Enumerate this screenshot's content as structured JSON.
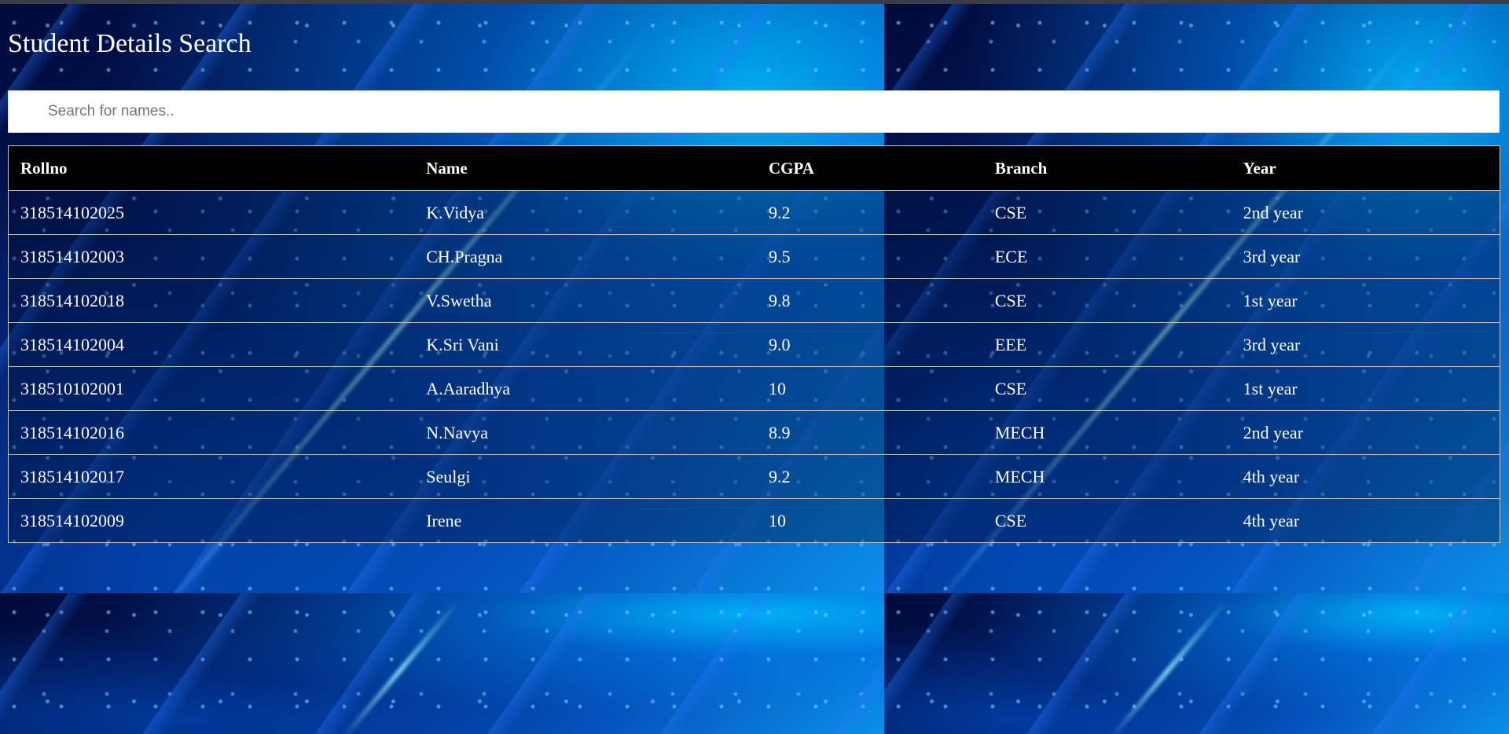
{
  "page": {
    "title": "Student Details Search"
  },
  "search": {
    "placeholder": "Search for names..",
    "value": ""
  },
  "table": {
    "headers": [
      "Rollno",
      "Name",
      "CGPA",
      "Branch",
      "Year"
    ],
    "rows": [
      [
        "318514102025",
        "K.Vidya",
        "9.2",
        "CSE",
        "2nd year"
      ],
      [
        "318514102003",
        "CH.Pragna",
        "9.5",
        "ECE",
        "3rd year"
      ],
      [
        "318514102018",
        "V.Swetha",
        "9.8",
        "CSE",
        "1st year"
      ],
      [
        "318514102004",
        "K.Sri Vani",
        "9.0",
        "EEE",
        "3rd year"
      ],
      [
        "318510102001",
        "A.Aaradhya",
        "10",
        "CSE",
        "1st year"
      ],
      [
        "318514102016",
        "N.Navya",
        "8.9",
        "MECH",
        "2nd year"
      ],
      [
        "318514102017",
        "Seulgi",
        "9.2",
        "MECH",
        "4th year"
      ],
      [
        "318514102009",
        "Irene",
        "10",
        "CSE",
        "4th year"
      ]
    ]
  },
  "colors": {
    "header_bg": "#000000",
    "text": "#ffffff",
    "border": "#c8c8c8",
    "background_accent": "#0a8fe8"
  }
}
